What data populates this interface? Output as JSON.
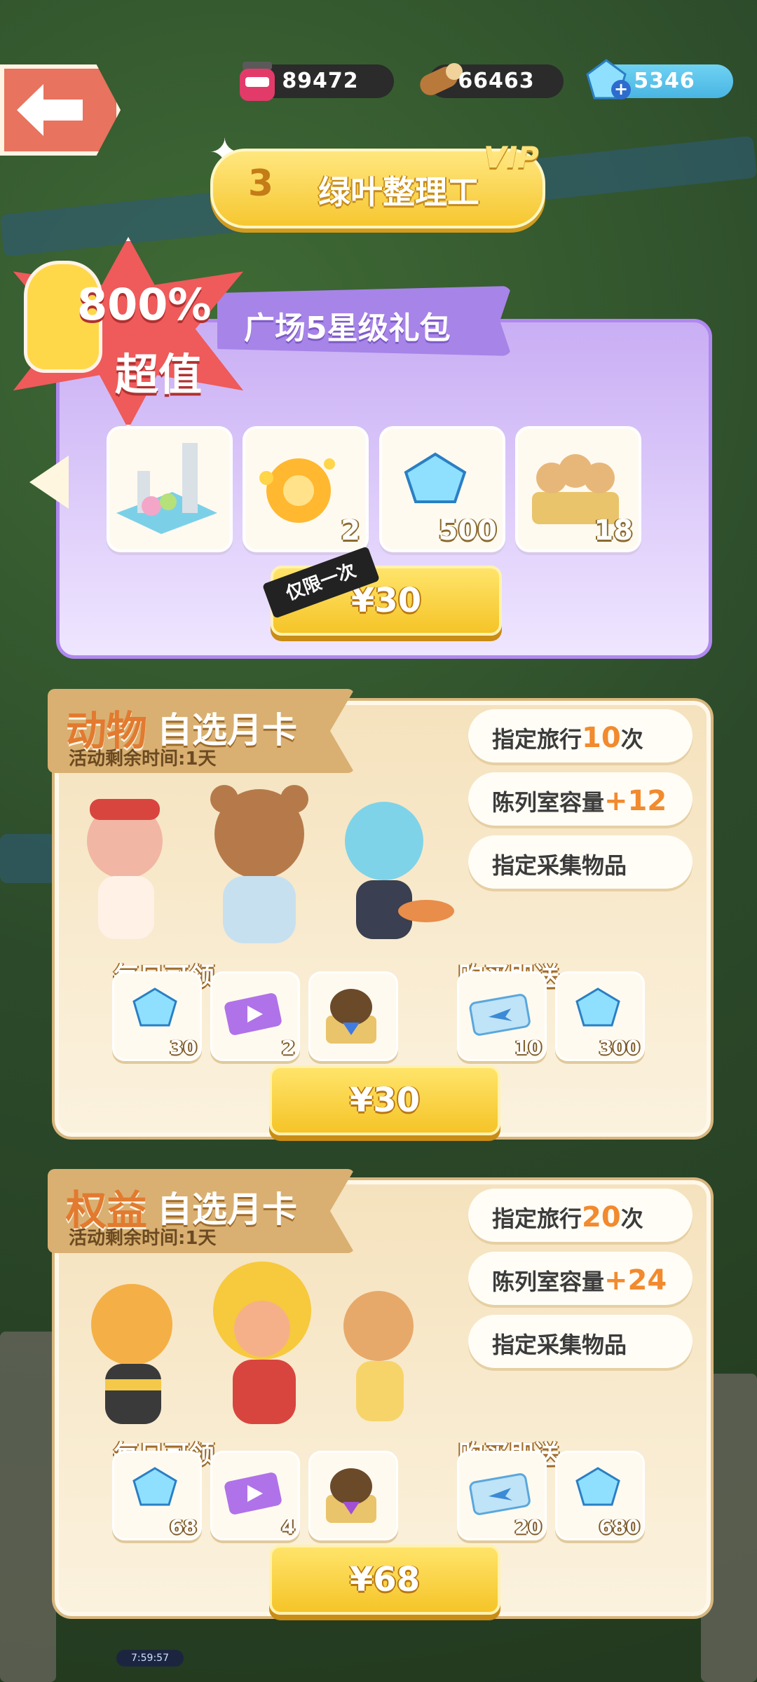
{
  "resources": {
    "jam": {
      "value": "89472",
      "icon": "jam-jar-icon"
    },
    "wood": {
      "value": "66463",
      "icon": "wood-log-icon"
    },
    "gems": {
      "value": "5346",
      "icon": "blue-gem-icon"
    }
  },
  "rank": {
    "level": "3",
    "title": "绿叶整理工",
    "vip_label": "VIP"
  },
  "gift_pack": {
    "badge_percent": "800%",
    "badge_text": "超值",
    "title": "广场5星级礼包",
    "items": [
      {
        "icon": "garden-decoration-icon",
        "count": ""
      },
      {
        "icon": "golden-orb-icon",
        "count": "2"
      },
      {
        "icon": "blue-gem-icon",
        "count": "500"
      },
      {
        "icon": "bread-basket-icon",
        "count": "18"
      }
    ],
    "limit_tag": "仅限一次",
    "price": "¥30"
  },
  "cards": [
    {
      "type": "动物",
      "name": "自选月卡",
      "timer": "活动剩余时间:1天",
      "perks": [
        {
          "label": "指定旅行",
          "value": "10",
          "suffix": "次"
        },
        {
          "label": "陈列室容量",
          "value": "+12",
          "suffix": ""
        },
        {
          "label": "指定采集物品",
          "value": "",
          "suffix": ""
        }
      ],
      "daily_label": "每日可领",
      "gift_label": "购买即送",
      "daily_items": [
        {
          "icon": "blue-gem-icon",
          "count": "30"
        },
        {
          "icon": "video-ticket-icon",
          "count": "2"
        },
        {
          "icon": "gift-basket-icon",
          "count": ""
        }
      ],
      "gift_items": [
        {
          "icon": "travel-ticket-icon",
          "count": "10"
        },
        {
          "icon": "blue-gem-icon",
          "count": "300"
        }
      ],
      "price": "¥30"
    },
    {
      "type": "权益",
      "name": "自选月卡",
      "timer": "活动剩余时间:1天",
      "perks": [
        {
          "label": "指定旅行",
          "value": "20",
          "suffix": "次"
        },
        {
          "label": "陈列室容量",
          "value": "+24",
          "suffix": ""
        },
        {
          "label": "指定采集物品",
          "value": "",
          "suffix": ""
        }
      ],
      "daily_label": "每日可领",
      "gift_label": "购买即送",
      "daily_items": [
        {
          "icon": "blue-gem-icon",
          "count": "68"
        },
        {
          "icon": "video-ticket-icon",
          "count": "4"
        },
        {
          "icon": "gift-basket-icon",
          "count": ""
        }
      ],
      "gift_items": [
        {
          "icon": "travel-ticket-icon",
          "count": "20"
        },
        {
          "icon": "blue-gem-icon",
          "count": "680"
        }
      ],
      "price": "¥68"
    }
  ],
  "footer_timer": "7:59:57"
}
